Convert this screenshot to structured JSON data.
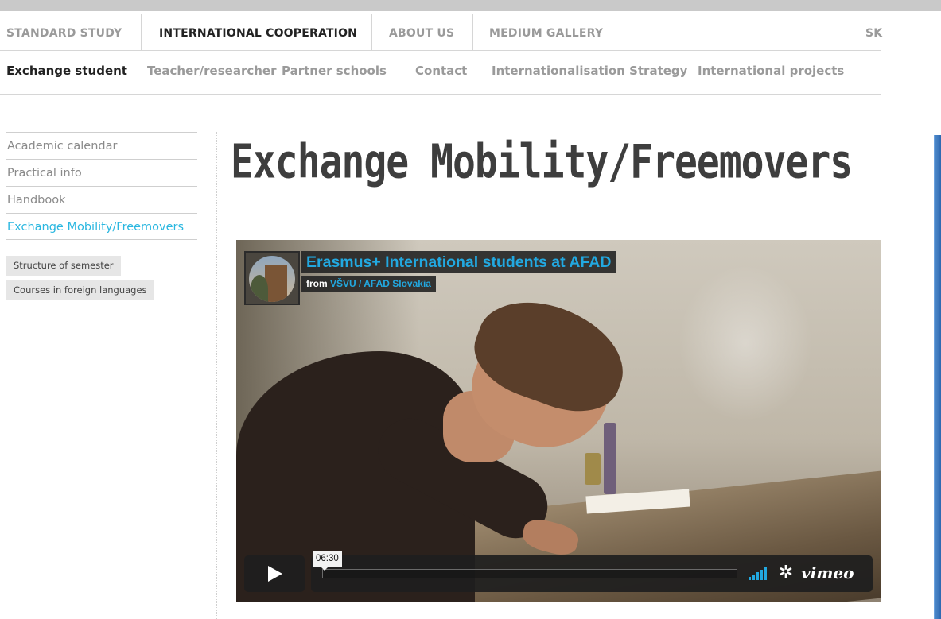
{
  "main_nav": {
    "items": [
      {
        "label": "STANDARD STUDY",
        "active": false
      },
      {
        "label": "INTERNATIONAL COOPERATION",
        "active": true
      },
      {
        "label": "ABOUT US",
        "active": false
      },
      {
        "label": "MEDIUM GALLERY",
        "active": false
      }
    ],
    "language": "SK"
  },
  "sub_nav": {
    "items": [
      {
        "label": "Exchange student",
        "active": true
      },
      {
        "label": "Teacher/researcher",
        "active": false
      },
      {
        "label": "Partner schools",
        "active": false
      },
      {
        "label": "Contact",
        "active": false
      },
      {
        "label": "Internationalisation Strategy",
        "active": false
      },
      {
        "label": "International projects",
        "active": false
      }
    ]
  },
  "sidebar": {
    "links": [
      {
        "label": "Academic calendar",
        "active": false
      },
      {
        "label": "Practical info",
        "active": false
      },
      {
        "label": "Handbook",
        "active": false
      },
      {
        "label": "Exchange Mobility/Freemovers",
        "active": true
      }
    ],
    "sub_buttons": [
      "Structure of semester",
      "Courses in foreign languages"
    ]
  },
  "page": {
    "title": "Exchange Mobility/Freemovers"
  },
  "video": {
    "title": "Erasmus+ International students at AFAD",
    "from_prefix": "from",
    "owner": "VŠVU / AFAD Slovakia",
    "duration": "06:30",
    "brand": "vimeo",
    "progress": 0
  },
  "colors": {
    "accent": "#2ab7e0",
    "vimeo_blue": "#22a8e0",
    "nav_inactive": "#9a9a9a",
    "nav_active": "#222222"
  },
  "icons": {
    "play": "play-icon",
    "volume": "volume-icon",
    "settings": "gear-icon"
  }
}
